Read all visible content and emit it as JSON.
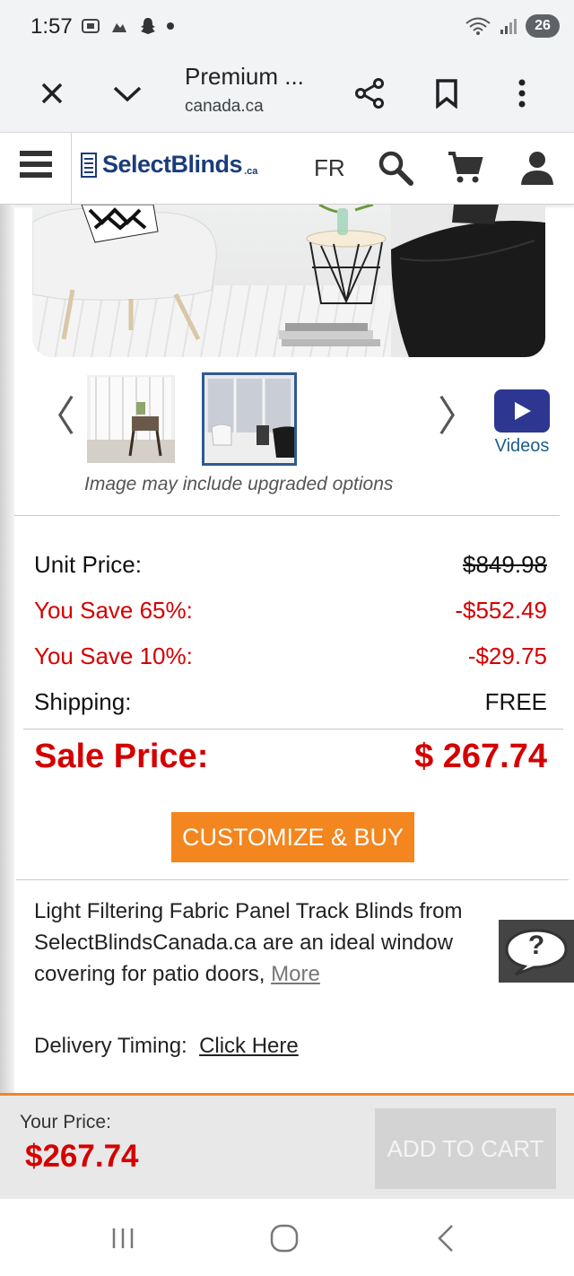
{
  "status_bar": {
    "time": "1:57",
    "battery": "26",
    "icons": [
      "screenshot-icon",
      "notification-icon",
      "snapchat-icon",
      "dot-icon",
      "wifi-icon",
      "signal-icon"
    ]
  },
  "browser": {
    "title": "Premium ...",
    "host": "canada.ca"
  },
  "site_header": {
    "logo_text": "SelectBlinds",
    "logo_suffix": ".ca",
    "lang": "FR"
  },
  "gallery": {
    "videos_label": "Videos",
    "caption": "Image may include upgraded options",
    "prev": "〈",
    "next": "〉"
  },
  "pricing": {
    "unit_price_label": "Unit Price:",
    "unit_price_value": "$849.98",
    "save1_label": "You Save 65%:",
    "save1_value": "-$552.49",
    "save2_label": "You Save 10%:",
    "save2_value": "-$29.75",
    "shipping_label": "Shipping:",
    "shipping_value": "FREE",
    "sale_label": "Sale Price:",
    "sale_value": "$ 267.74"
  },
  "cta": {
    "label": "CUSTOMIZE & BUY"
  },
  "description": {
    "text": "Light Filtering Fabric Panel Track Blinds from SelectBlindsCanada.ca are an ideal window covering for patio doors, ",
    "more_link": "More"
  },
  "delivery": {
    "label": "Delivery Timing:",
    "link": "Click Here"
  },
  "chat": {
    "glyph": "?"
  },
  "bottom_bar": {
    "your_price_label": "Your Price:",
    "your_price_value": "$267.74",
    "add_to_cart": "ADD TO CART"
  },
  "colors": {
    "accent_orange": "#f3861f",
    "price_red": "#d40000",
    "brand_blue": "#1a3c7a",
    "video_button": "#2d3690"
  }
}
